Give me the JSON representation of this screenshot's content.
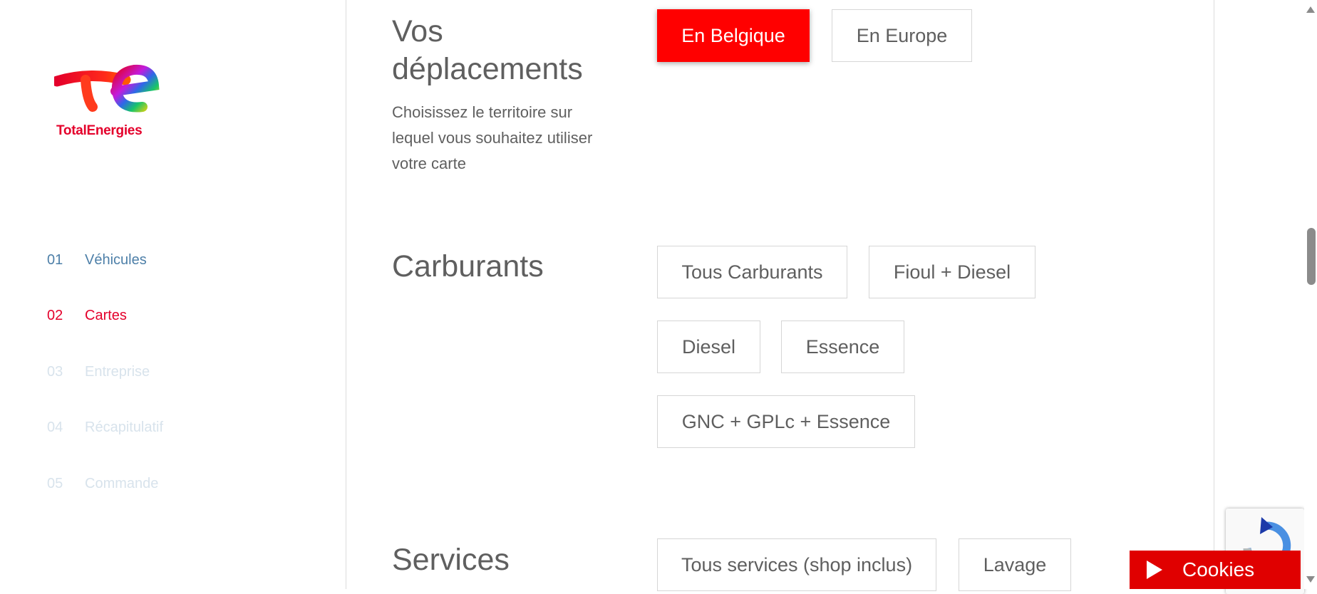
{
  "sidebar": {
    "logo_text": "TotalEnergies",
    "steps": [
      {
        "num": "01",
        "label": "Véhicules",
        "state": "done"
      },
      {
        "num": "02",
        "label": "Cartes",
        "state": "active"
      },
      {
        "num": "03",
        "label": "Entreprise",
        "state": "todo"
      },
      {
        "num": "04",
        "label": "Récapitulatif",
        "state": "todo"
      },
      {
        "num": "05",
        "label": "Commande",
        "state": "todo"
      }
    ]
  },
  "sections": {
    "deplacements": {
      "title_line1": "Vos",
      "title_line2": "déplacements",
      "description": "Choisissez le territoire sur lequel vous souhaitez utiliser votre carte",
      "options": [
        {
          "label": "En Belgique",
          "selected": true
        },
        {
          "label": "En Europe",
          "selected": false
        }
      ]
    },
    "carburants": {
      "title": "Carburants",
      "options": [
        {
          "label": "Tous Carburants",
          "selected": false
        },
        {
          "label": "Fioul + Diesel",
          "selected": false
        },
        {
          "label": "Diesel",
          "selected": false
        },
        {
          "label": "Essence",
          "selected": false
        },
        {
          "label": "GNC + GPLc + Essence",
          "selected": false
        }
      ]
    },
    "services": {
      "title": "Services",
      "options": [
        {
          "label": "Tous services (shop inclus)",
          "selected": false
        },
        {
          "label": "Lavage",
          "selected": false
        }
      ]
    }
  },
  "cookies": {
    "label": "Cookies"
  },
  "colors": {
    "brand_red": "#ff0000",
    "step_done": "#4d7fa8",
    "step_active": "#e4002b",
    "step_todo": "#d8e3ec"
  }
}
